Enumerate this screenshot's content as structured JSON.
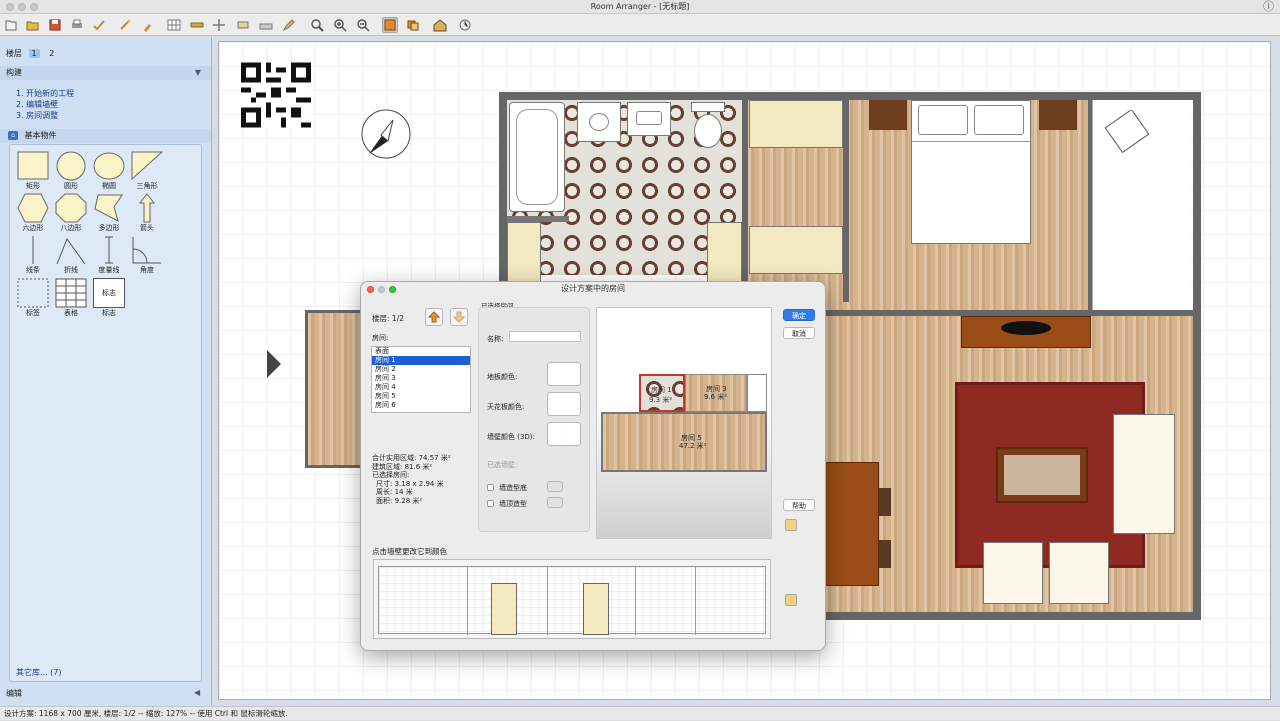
{
  "window": {
    "title": "Room Arranger - [无标题]"
  },
  "sidebar": {
    "floor_label": "楼层",
    "floors": [
      "1",
      "2"
    ],
    "build_header": "构建",
    "steps": [
      "1. 开始新的工程",
      "2. 编辑墙壁",
      "3. 房间调整"
    ],
    "library_header": "基本物件",
    "shapes": [
      {
        "label": "矩形",
        "icon": "rectangle-icon"
      },
      {
        "label": "圆形",
        "icon": "circle-icon"
      },
      {
        "label": "椭圆",
        "icon": "ellipse-icon"
      },
      {
        "label": "三角形",
        "icon": "triangle-icon"
      },
      {
        "label": "六边形",
        "icon": "hexagon-icon"
      },
      {
        "label": "八边形",
        "icon": "octagon-icon"
      },
      {
        "label": "多边形",
        "icon": "polygon-icon"
      },
      {
        "label": "箭头",
        "icon": "arrow-icon"
      },
      {
        "label": "线条",
        "icon": "line-icon"
      },
      {
        "label": "折线",
        "icon": "polyline-icon"
      },
      {
        "label": "度量线",
        "icon": "dimension-line-icon"
      },
      {
        "label": "角度",
        "icon": "angle-icon"
      },
      {
        "label": "标签",
        "icon": "label-icon"
      },
      {
        "label": "表格",
        "icon": "table-icon"
      },
      {
        "label": "标志",
        "icon": "sign-icon",
        "inner_text": "标志"
      }
    ],
    "other_libraries": "其它库... (7)",
    "edit_label": "编辑"
  },
  "dialog": {
    "title": "设计方案中的房间",
    "floor": "楼层: 1/2",
    "rooms_label": "房间:",
    "rooms": [
      "表面",
      "房间 1",
      "房间 2",
      "房间 3",
      "房间 4",
      "房间 5",
      "房间 6"
    ],
    "selected_room_index": 1,
    "stats": {
      "total_area": "合计实用区域: 74.57 米²",
      "built_area": "建筑区域: 81.6 米²",
      "selected_room": "已选择房间:",
      "size": "尺寸: 3.18 x 2.94 米",
      "perimeter": "周长: 14 米",
      "area": "面积: 9.28 米²"
    },
    "selected_section": "已选择房间",
    "name_label": "名称:",
    "name_value": "",
    "floor_color_label": "地板颜色:",
    "ceiling_color_label": "天花板颜色:",
    "wall_color_label": "墙壁颜色 (3D):",
    "wall_shape_label": "已选墙壁:",
    "wall_base_label": "墙造型底",
    "wall_top_label": "墙顶造型",
    "ok_button": "确定",
    "cancel_button": "取消",
    "help_button": "帮助",
    "preview_rooms": [
      {
        "name": "房间 1",
        "area": "9.3 米²"
      },
      {
        "name": "房间 3",
        "area": "9.6 米²"
      },
      {
        "name": "房间 5",
        "area": "47.2 米²"
      }
    ],
    "wall_prompt": "点击墙壁更改它到颜色"
  },
  "status": {
    "text": "设计方案: 1168 x 700 厘米, 楼层: 1/2 -- 缩放: 127% -- 使用 Ctrl 和 鼠标滑轮缩放."
  },
  "colors": {
    "sidebar_bg": "#cfe0f3",
    "accent": "#2f7bea",
    "selected_row": "#1f5fd6",
    "rug": "#8e2a22"
  }
}
